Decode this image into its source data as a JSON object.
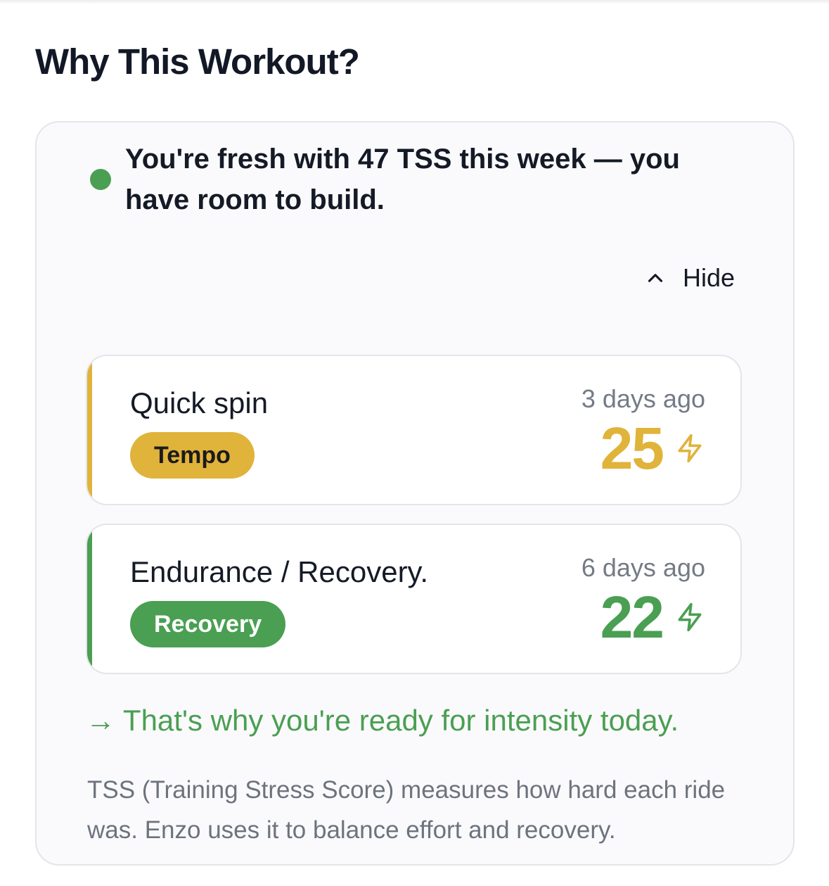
{
  "section": {
    "title": "Why This Workout?"
  },
  "summary": {
    "text": "You're fresh with 47 TSS this week — you have room to build."
  },
  "toggle": {
    "label": "Hide",
    "icon": "chevron-up-icon"
  },
  "rides": [
    {
      "name": "Quick spin",
      "tag": "Tempo",
      "when": "3 days ago",
      "tss": "25",
      "color": "#e0b33b",
      "tag_text_color": "#1b1b1b",
      "icon": "lightning-bolt-icon"
    },
    {
      "name": "Endurance / Recovery.",
      "tag": "Recovery",
      "when": "6 days ago",
      "tss": "22",
      "color": "#4a9f52",
      "tag_text_color": "#ffffff",
      "icon": "lightning-bolt-icon"
    }
  ],
  "conclusion": {
    "text": "→ That's why you're ready for intensity today."
  },
  "footnote": {
    "text": "TSS (Training Stress Score) measures how hard each ride was. Enzo uses it to balance effort and recovery."
  },
  "colors": {
    "accent_green": "#4a9f52",
    "accent_yellow": "#e0b33b"
  }
}
